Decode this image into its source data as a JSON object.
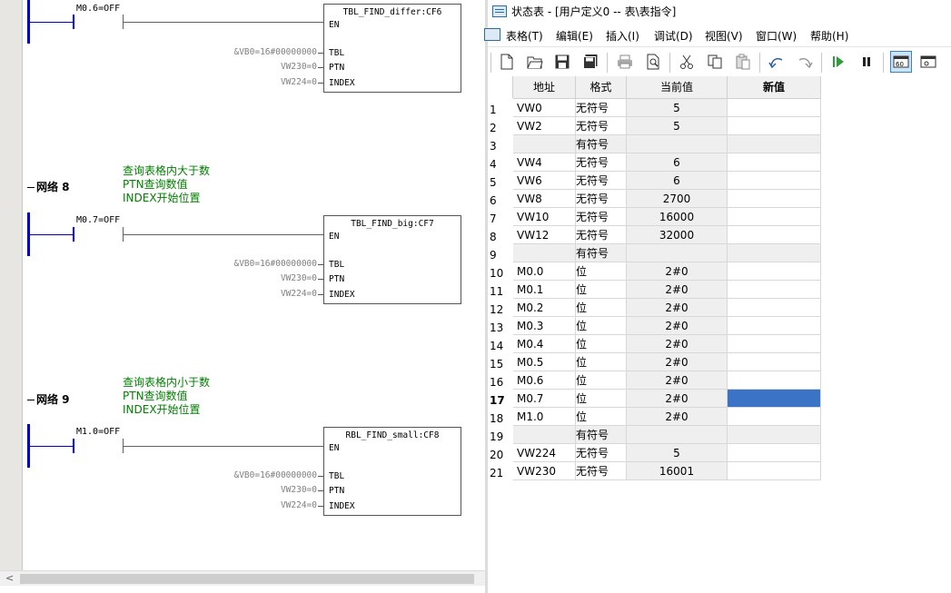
{
  "ladder": {
    "networks": [
      {
        "label": "",
        "comments": [],
        "contact": "M0.6=OFF",
        "box_title": "TBL_FIND_differ:CF6",
        "en": "EN",
        "pins": [
          {
            "param": "&VB0=16#00000000",
            "pin": "TBL"
          },
          {
            "param": "VW230=0",
            "pin": "PTN"
          },
          {
            "param": "VW224=0",
            "pin": "INDEX"
          }
        ]
      },
      {
        "label": "网络 8",
        "comments": [
          "查询表格内大于数",
          "PTN查询数值",
          "INDEX开始位置"
        ],
        "contact": "M0.7=OFF",
        "box_title": "TBL_FIND_big:CF7",
        "en": "EN",
        "pins": [
          {
            "param": "&VB0=16#00000000",
            "pin": "TBL"
          },
          {
            "param": "VW230=0",
            "pin": "PTN"
          },
          {
            "param": "VW224=0",
            "pin": "INDEX"
          }
        ]
      },
      {
        "label": "网络 9",
        "comments": [
          "查询表格内小于数",
          "PTN查询数值",
          "INDEX开始位置"
        ],
        "contact": "M1.0=OFF",
        "box_title": "RBL_FIND_small:CF8",
        "en": "EN",
        "pins": [
          {
            "param": "&VB0=16#00000000",
            "pin": "TBL"
          },
          {
            "param": "VW230=0",
            "pin": "PTN"
          },
          {
            "param": "VW224=0",
            "pin": "INDEX"
          }
        ]
      }
    ],
    "scroll_left_arrow": "<"
  },
  "status_window": {
    "title": "状态表 - [用户定义0 -- 表\\表指令]",
    "menu": [
      "表格(T)",
      "编辑(E)",
      "插入(I)",
      "调试(D)",
      "视图(V)",
      "窗口(W)",
      "帮助(H)"
    ],
    "toolbar_icons": [
      "new-icon",
      "open-icon",
      "save-icon",
      "save-all-icon",
      "print-icon",
      "print-preview-icon",
      "cut-icon",
      "copy-icon",
      "paste-icon",
      "undo-icon",
      "redo-icon",
      "run-icon",
      "pause-icon",
      "trend-view-icon",
      "single-read-icon"
    ],
    "columns": [
      "地址",
      "格式",
      "当前值",
      "新值"
    ],
    "rows": [
      {
        "n": "1",
        "addr": "VW0",
        "fmt": "无符号",
        "cur": "5",
        "new": ""
      },
      {
        "n": "2",
        "addr": "VW2",
        "fmt": "无符号",
        "cur": "5",
        "new": ""
      },
      {
        "n": "3",
        "addr": "",
        "fmt": "有符号",
        "cur": "",
        "new": "",
        "grey": true
      },
      {
        "n": "4",
        "addr": "VW4",
        "fmt": "无符号",
        "cur": "6",
        "new": ""
      },
      {
        "n": "5",
        "addr": "VW6",
        "fmt": "无符号",
        "cur": "6",
        "new": ""
      },
      {
        "n": "6",
        "addr": "VW8",
        "fmt": "无符号",
        "cur": "2700",
        "new": ""
      },
      {
        "n": "7",
        "addr": "VW10",
        "fmt": "无符号",
        "cur": "16000",
        "new": ""
      },
      {
        "n": "8",
        "addr": "VW12",
        "fmt": "无符号",
        "cur": "32000",
        "new": ""
      },
      {
        "n": "9",
        "addr": "",
        "fmt": "有符号",
        "cur": "",
        "new": "",
        "grey": true
      },
      {
        "n": "10",
        "addr": "M0.0",
        "fmt": "位",
        "cur": "2#0",
        "new": ""
      },
      {
        "n": "11",
        "addr": "M0.1",
        "fmt": "位",
        "cur": "2#0",
        "new": ""
      },
      {
        "n": "12",
        "addr": "M0.2",
        "fmt": "位",
        "cur": "2#0",
        "new": ""
      },
      {
        "n": "13",
        "addr": "M0.3",
        "fmt": "位",
        "cur": "2#0",
        "new": ""
      },
      {
        "n": "14",
        "addr": "M0.4",
        "fmt": "位",
        "cur": "2#0",
        "new": ""
      },
      {
        "n": "15",
        "addr": "M0.5",
        "fmt": "位",
        "cur": "2#0",
        "new": ""
      },
      {
        "n": "16",
        "addr": "M0.6",
        "fmt": "位",
        "cur": "2#0",
        "new": ""
      },
      {
        "n": "17",
        "addr": "M0.7",
        "fmt": "位",
        "cur": "2#0",
        "new": "",
        "selected": true
      },
      {
        "n": "18",
        "addr": "M1.0",
        "fmt": "位",
        "cur": "2#0",
        "new": ""
      },
      {
        "n": "19",
        "addr": "",
        "fmt": "有符号",
        "cur": "",
        "new": "",
        "grey": true
      },
      {
        "n": "20",
        "addr": "VW224",
        "fmt": "无符号",
        "cur": "5",
        "new": ""
      },
      {
        "n": "21",
        "addr": "VW230",
        "fmt": "无符号",
        "cur": "16001",
        "new": ""
      }
    ],
    "colors": {
      "selection": "#3b73c6",
      "rail": "#0000c8",
      "comment": "#008000"
    }
  }
}
